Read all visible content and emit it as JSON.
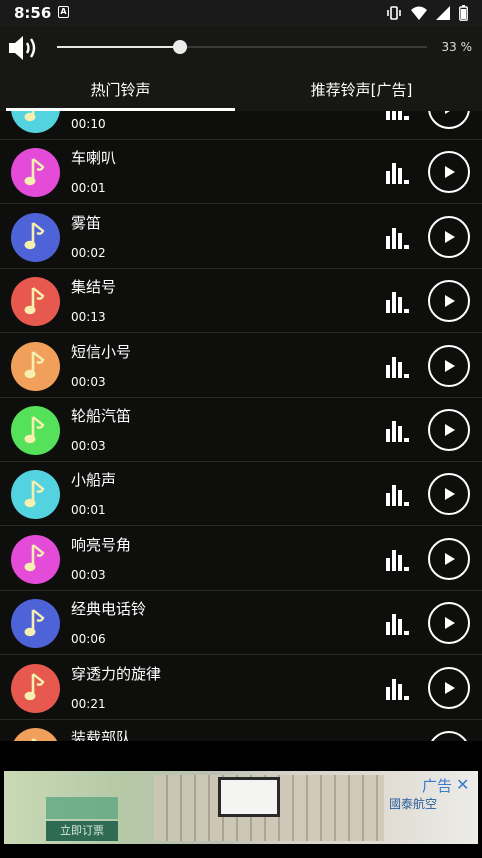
{
  "status": {
    "time": "8:56",
    "notification_icon": "A"
  },
  "volume": {
    "percent_label": "33 %",
    "level": 0.33
  },
  "tabs": [
    {
      "label": "热门铃声",
      "active": true
    },
    {
      "label": "推荐铃声[广告]",
      "active": false
    }
  ],
  "rows": [
    {
      "title": "",
      "duration": "00:10",
      "color": "#53d3df"
    },
    {
      "title": "车喇叭",
      "duration": "00:01",
      "color": "#e34bd8"
    },
    {
      "title": "雾笛",
      "duration": "00:02",
      "color": "#4f63d8"
    },
    {
      "title": "集结号",
      "duration": "00:13",
      "color": "#e7594e"
    },
    {
      "title": "短信小号",
      "duration": "00:03",
      "color": "#f0a05a"
    },
    {
      "title": "轮船汽笛",
      "duration": "00:03",
      "color": "#56e15b"
    },
    {
      "title": "小船声",
      "duration": "00:01",
      "color": "#53d3df"
    },
    {
      "title": "响亮号角",
      "duration": "00:03",
      "color": "#e34bd8"
    },
    {
      "title": "经典电话铃",
      "duration": "00:06",
      "color": "#4f63d8"
    },
    {
      "title": "穿透力的旋律",
      "duration": "00:21",
      "color": "#e7594e"
    },
    {
      "title": "装载部队",
      "duration": "",
      "color": "#f0a05a"
    }
  ],
  "ad": {
    "label": "广告",
    "close": "✕",
    "cta": "立即订票",
    "brand": "國泰航空"
  }
}
